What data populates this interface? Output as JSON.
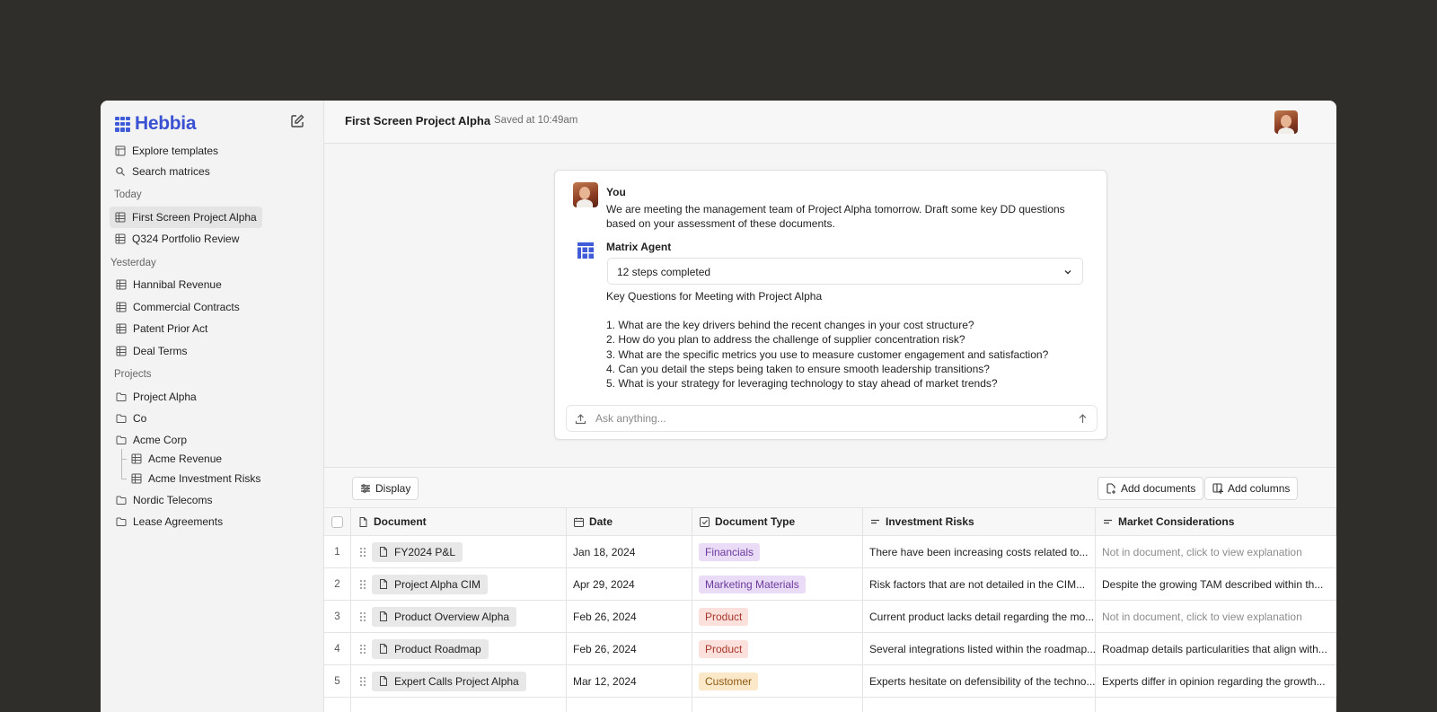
{
  "app": {
    "brand": "Hebbia",
    "brand_color": "#3a52d2"
  },
  "sidebar": {
    "top_items": [
      {
        "label": "Explore templates",
        "icon": "template-icon"
      },
      {
        "label": "Search matrices",
        "icon": "search-icon"
      }
    ],
    "sections": [
      {
        "title": "Today",
        "items": [
          {
            "label": "First Screen Project Alpha",
            "active": true
          },
          {
            "label": "Q324 Portfolio Review"
          }
        ]
      },
      {
        "title": "Yesterday",
        "items": [
          {
            "label": "Hannibal Revenue"
          },
          {
            "label": "Commercial Contracts"
          },
          {
            "label": "Patent Prior Act"
          },
          {
            "label": "Deal Terms"
          }
        ]
      },
      {
        "title": "Projects",
        "items": [
          {
            "label": "Project Alpha"
          },
          {
            "label": "Co"
          },
          {
            "label": "Acme Corp",
            "children": [
              "Acme Revenue",
              "Acme Investment Risks"
            ]
          },
          {
            "label": "Nordic Telecoms"
          },
          {
            "label": "Lease Agreements"
          }
        ]
      }
    ]
  },
  "header": {
    "title": "First Screen Project Alpha",
    "saved": "Saved at 10:49am"
  },
  "chat": {
    "user_name": "You",
    "user_message": "We are meeting the management team of Project Alpha tomorrow. Draft some key DD questions based on your assessment of these documents.",
    "agent_name": "Matrix Agent",
    "steps": "12 steps completed",
    "answer_title": "Key Questions for Meeting with Project Alpha",
    "answers": [
      "1. What are the key drivers behind the recent changes in your cost structure?",
      "2. How do you plan to address the challenge of supplier concentration risk?",
      "3. What are the specific metrics you use to measure customer engagement and satisfaction?",
      "4. Can you detail the steps being taken to ensure smooth leadership transitions?",
      "5. What is your strategy for leveraging technology to stay ahead of market trends?"
    ],
    "ask_placeholder": "Ask anything..."
  },
  "toolbar": {
    "display": "Display",
    "add_documents": "Add documents",
    "add_columns": "Add columns"
  },
  "table": {
    "columns": [
      "Document",
      "Date",
      "Document Type",
      "Investment Risks",
      "Market Considerations"
    ],
    "rows": [
      {
        "num": "1",
        "doc": "FY2024 P&L",
        "date": "Jan 18, 2024",
        "type": "Financials",
        "type_bg": "#eadcf7",
        "type_fg": "#6b3a9c",
        "risks": "There have been increasing costs related to...",
        "market": "Not in document, click to view explanation",
        "market_muted": true
      },
      {
        "num": "2",
        "doc": "Project Alpha CIM",
        "date": "Apr 29, 2024",
        "type": "Marketing Materials",
        "type_bg": "#eadcf7",
        "type_fg": "#6b3a9c",
        "risks": "Risk factors that are not detailed in the CIM...",
        "market": "Despite the growing TAM described within th...",
        "market_muted": false
      },
      {
        "num": "3",
        "doc": "Product Overview Alpha",
        "date": "Feb 26, 2024",
        "type": "Product",
        "type_bg": "#fbe0dc",
        "type_fg": "#a8382b",
        "risks": "Current product lacks detail regarding the mo...",
        "market": "Not in document, click to view explanation",
        "market_muted": true
      },
      {
        "num": "4",
        "doc": "Product Roadmap",
        "date": "Feb 26, 2024",
        "type": "Product",
        "type_bg": "#fbe0dc",
        "type_fg": "#a8382b",
        "risks": "Several integrations listed within the roadmap...",
        "market": "Roadmap details particularities that align with...",
        "market_muted": false
      },
      {
        "num": "5",
        "doc": "Expert Calls Project Alpha",
        "date": "Mar 12, 2024",
        "type": "Customer",
        "type_bg": "#fbe8c9",
        "type_fg": "#8f5a12",
        "risks": "Experts hesitate on defensibility of the techno...",
        "market": "Experts differ in opinion regarding the growth...",
        "market_muted": false
      }
    ]
  }
}
